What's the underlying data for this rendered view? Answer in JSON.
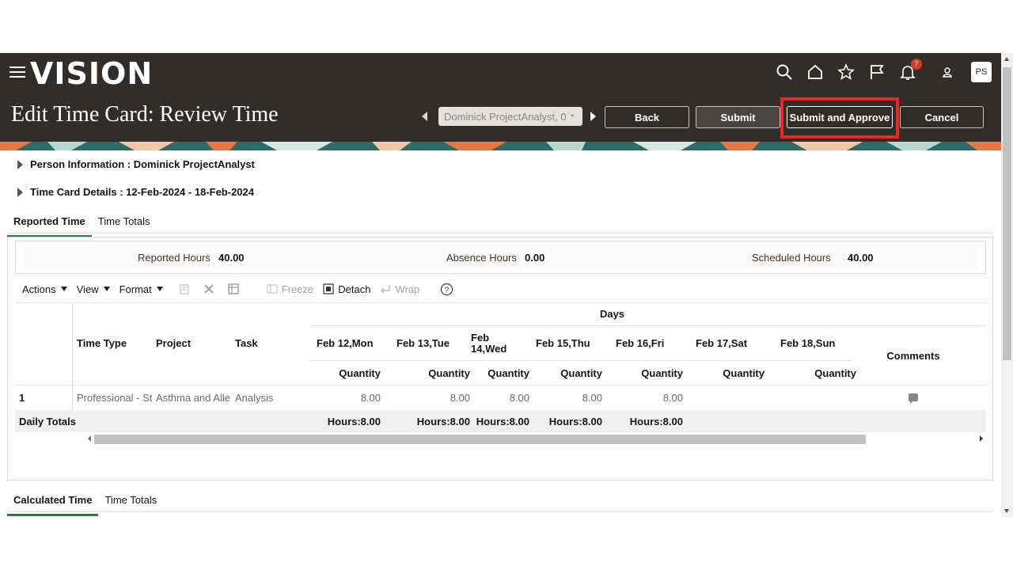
{
  "app": {
    "logo": "VISION",
    "notification_count": "7",
    "user_initials": "PS"
  },
  "header": {
    "title": "Edit Time Card: Review Time",
    "person_select_value": "Dominick ProjectAnalyst, 0",
    "buttons": {
      "back": "Back",
      "submit": "Submit",
      "submit_approve": "Submit and Approve",
      "cancel": "Cancel"
    },
    "icons": [
      "search-icon",
      "home-icon",
      "star-icon",
      "flag-icon",
      "bell-icon",
      "person-icon"
    ]
  },
  "sections": {
    "person_info": "Person Information : Dominick ProjectAnalyst",
    "time_card_details": "Time Card Details : 12-Feb-2024 - 18-Feb-2024"
  },
  "reported_tabs": [
    "Reported Time",
    "Time Totals"
  ],
  "summary": {
    "reported_label": "Reported Hours",
    "reported_value": "40.00",
    "absence_label": "Absence Hours",
    "absence_value": "0.00",
    "scheduled_label": "Scheduled Hours",
    "scheduled_value": "40.00"
  },
  "toolbar": {
    "actions": "Actions",
    "view": "View",
    "format": "Format",
    "freeze": "Freeze",
    "detach": "Detach",
    "wrap": "Wrap"
  },
  "grid": {
    "days_header": "Days",
    "col_time_type": "Time Type",
    "col_project": "Project",
    "col_task": "Task",
    "col_comments": "Comments",
    "days": [
      "Feb 12,Mon",
      "Feb 13,Tue",
      "Feb\n14,Wed",
      "Feb 15,Thu",
      "Feb 16,Fri",
      "Feb 17,Sat",
      "Feb 18,Sun"
    ],
    "quantity": "Quantity",
    "row": {
      "num": "1",
      "time_type": "Professional - St",
      "project": "Asthma and Alle",
      "task": "Analysis",
      "values": [
        "8.00",
        "8.00",
        "8.00",
        "8.00",
        "8.00",
        "",
        ""
      ]
    },
    "totals_label": "Daily Totals",
    "totals": [
      "Hours:8.00",
      "Hours:8.00",
      "Hours:8.00",
      "Hours:8.00",
      "Hours:8.00",
      "",
      ""
    ]
  },
  "calculated_tabs": [
    "Calculated Time",
    "Time Totals"
  ]
}
